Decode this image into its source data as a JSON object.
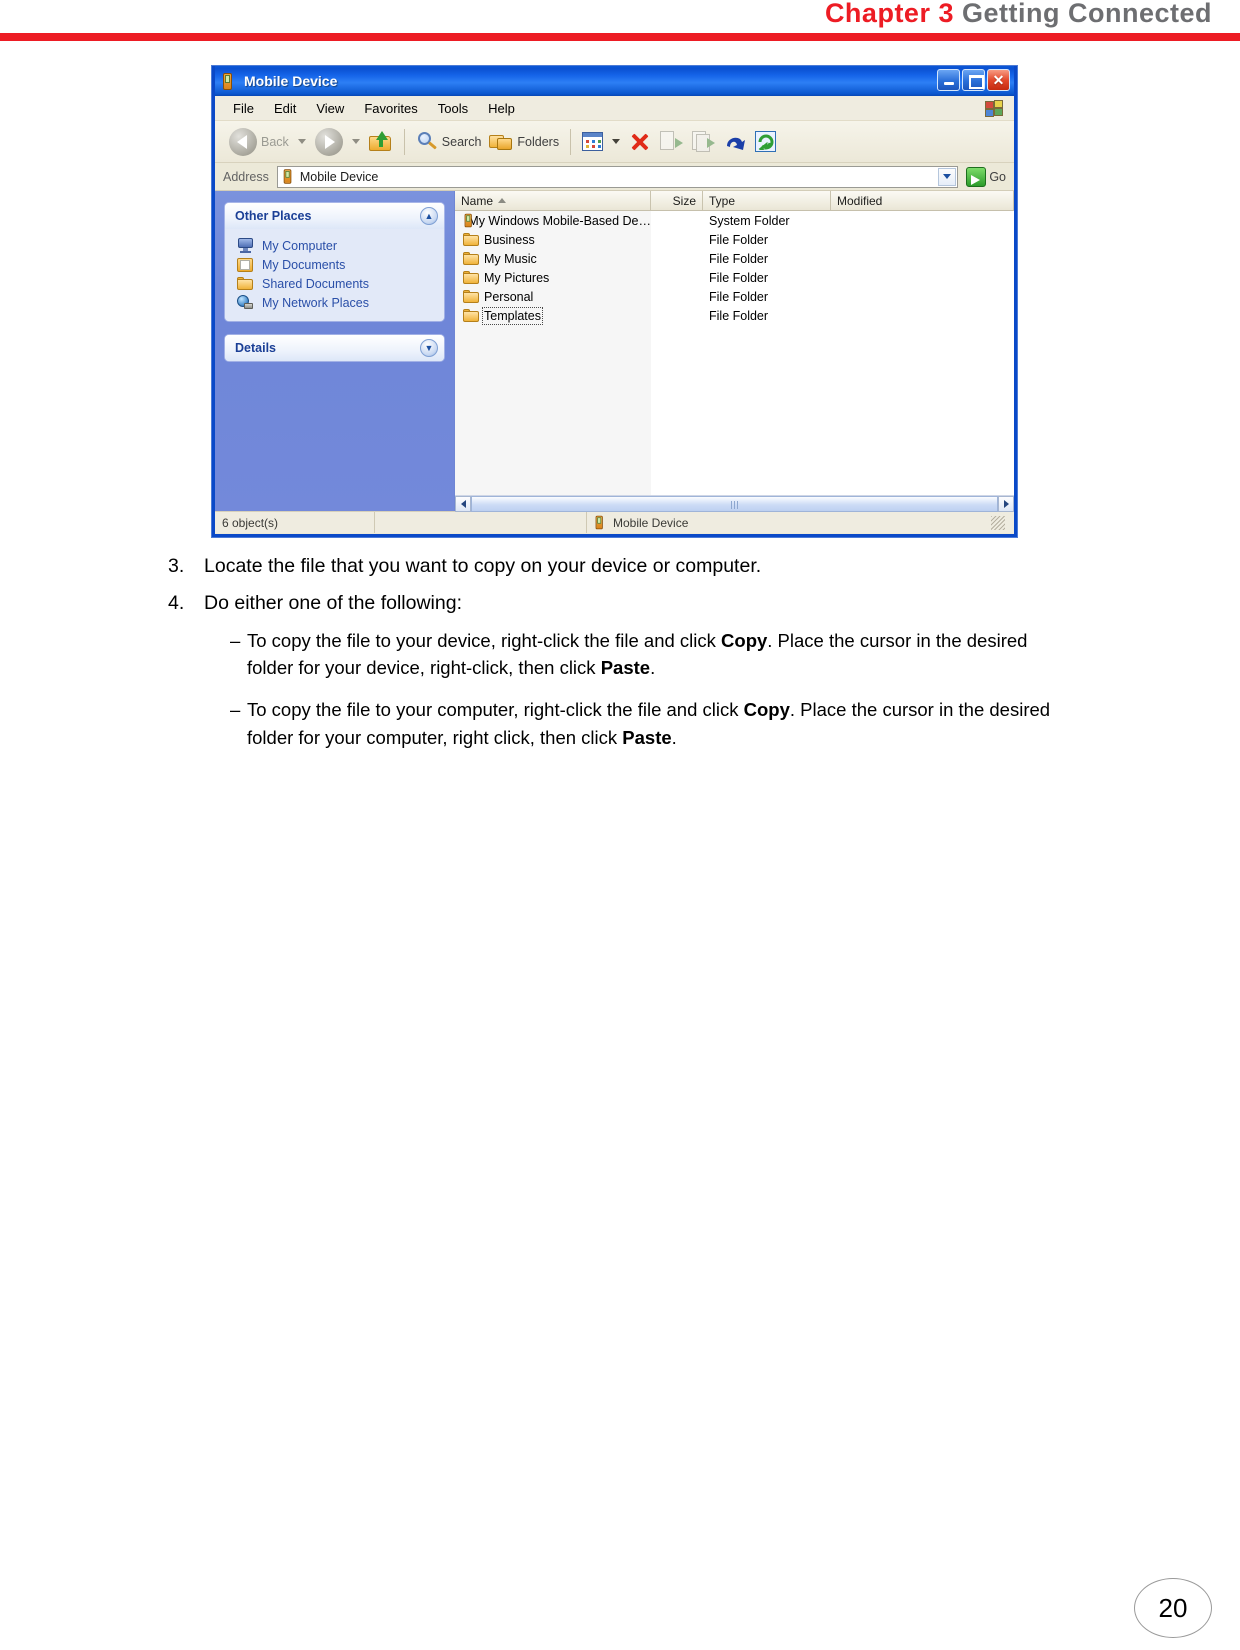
{
  "header": {
    "chapter": "Chapter 3",
    "section": "Getting Connected"
  },
  "window": {
    "title": "Mobile Device",
    "title_icon": "mobile-device-icon",
    "controls": {
      "minimize": "minimize-button",
      "maximize": "maximize-button",
      "close_glyph": "✕"
    },
    "menu": [
      "File",
      "Edit",
      "View",
      "Favorites",
      "Tools",
      "Help"
    ],
    "toolbar": {
      "back_label": "Back",
      "search_label": "Search",
      "folders_label": "Folders",
      "icons": [
        "back-icon",
        "back-dropdown-icon",
        "forward-icon",
        "forward-dropdown-icon",
        "up-one-level-icon",
        "search-icon",
        "folders-icon",
        "views-icon",
        "views-dropdown-icon",
        "delete-icon",
        "move-to-icon",
        "copy-to-icon",
        "undo-icon",
        "refresh-icon"
      ]
    },
    "address": {
      "label": "Address",
      "value": "Mobile Device",
      "go_label": "Go"
    },
    "task_pane": {
      "groups": [
        {
          "title": "Other Places",
          "chevron": "collapse",
          "items": [
            {
              "label": "My Computer",
              "icon": "my-computer-icon"
            },
            {
              "label": "My Documents",
              "icon": "my-documents-icon"
            },
            {
              "label": "Shared Documents",
              "icon": "shared-documents-icon"
            },
            {
              "label": "My Network Places",
              "icon": "my-network-places-icon"
            }
          ]
        },
        {
          "title": "Details",
          "chevron": "expand",
          "items": []
        }
      ]
    },
    "file_list": {
      "columns": [
        "Name",
        "Size",
        "Type",
        "Modified"
      ],
      "sort_column": "Name",
      "sort_direction": "ascending",
      "rows": [
        {
          "name": "My Windows Mobile-Based De…",
          "size": "",
          "type": "System Folder",
          "modified": "",
          "icon": "mobile-device-icon",
          "focused": false
        },
        {
          "name": "Business",
          "size": "",
          "type": "File Folder",
          "modified": "",
          "icon": "folder-icon",
          "focused": false
        },
        {
          "name": "My Music",
          "size": "",
          "type": "File Folder",
          "modified": "",
          "icon": "folder-icon",
          "focused": false
        },
        {
          "name": "My Pictures",
          "size": "",
          "type": "File Folder",
          "modified": "",
          "icon": "folder-icon",
          "focused": false
        },
        {
          "name": "Personal",
          "size": "",
          "type": "File Folder",
          "modified": "",
          "icon": "folder-icon",
          "focused": false
        },
        {
          "name": "Templates",
          "size": "",
          "type": "File Folder",
          "modified": "",
          "icon": "folder-icon",
          "focused": true
        }
      ]
    },
    "status_bar": {
      "objects": "6 object(s)",
      "middle": "",
      "location": "Mobile Device"
    }
  },
  "steps": [
    {
      "num": "3.",
      "text": "Locate the file that you want to copy on your device or computer."
    },
    {
      "num": "4.",
      "text": "Do either one of the following:"
    }
  ],
  "substeps": [
    {
      "dash": "–",
      "parts": [
        "To copy the file to your device, right-click the file and click ",
        "Copy",
        ". Place the cursor in the desired folder for your device, right-click, then click ",
        "Paste",
        "."
      ]
    },
    {
      "dash": "–",
      "parts": [
        "To copy the file to your computer, right-click the file and click ",
        "Copy",
        ". Place the cursor in the desired folder for your computer, right click, then click ",
        "Paste",
        "."
      ]
    }
  ],
  "page_number": "20",
  "colors": {
    "accent_red": "#ed1c24",
    "header_gray": "#6d6e71",
    "title_blue": "#0a49c8",
    "task_pane_blue": "#7389da",
    "link_blue": "#2a4fa8"
  }
}
